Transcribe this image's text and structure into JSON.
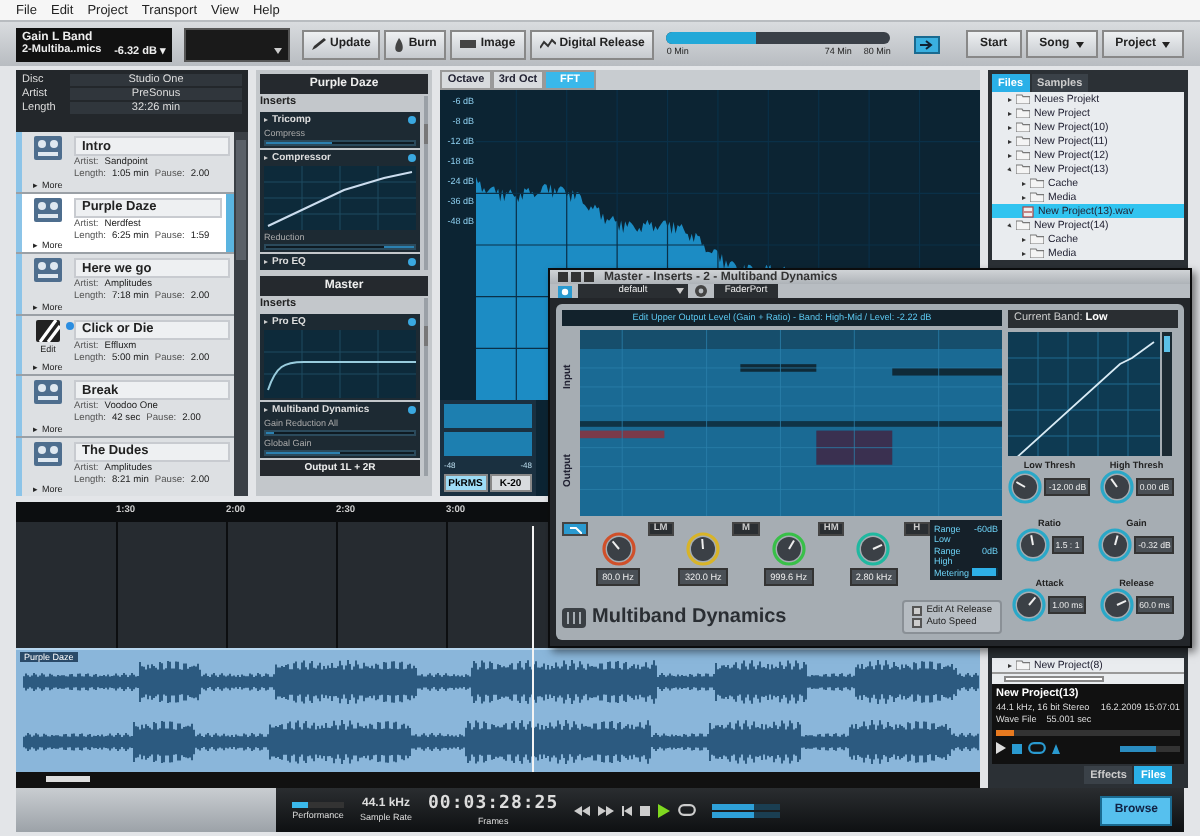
{
  "menu": [
    "File",
    "Edit",
    "Project",
    "Transport",
    "View",
    "Help"
  ],
  "toolbar": {
    "parameter": {
      "name": "Gain L Band",
      "plugin": "2-Multiba..mics",
      "value": "-6.32 dB ▾"
    },
    "actions": [
      "Update",
      "Burn",
      "Image",
      "Digital Release"
    ],
    "disc_usage": {
      "level": 0.4,
      "ticks": [
        "0 Min",
        "74 Min",
        "80 Min"
      ]
    },
    "pages": [
      {
        "label": "Start",
        "dropdown": false
      },
      {
        "label": "Song",
        "dropdown": true
      },
      {
        "label": "Project",
        "dropdown": true
      }
    ]
  },
  "disc": {
    "fields": [
      {
        "label": "Disc",
        "value": "Studio One"
      },
      {
        "label": "Artist",
        "value": "PreSonus"
      },
      {
        "label": "Length",
        "value": "32:26 min"
      }
    ]
  },
  "tracks": [
    {
      "title": "Intro",
      "kind": "cd",
      "selected": false,
      "more": "▸ More",
      "fields": [
        [
          "Artist:",
          "Sandpoint"
        ],
        [
          "Length:",
          "1:05 min"
        ],
        [
          "Pause:",
          "2.00"
        ]
      ]
    },
    {
      "title": "Purple Daze",
      "kind": "cd",
      "selected": true,
      "more": "▸ More",
      "fields": [
        [
          "Artist:",
          "Nerdfest"
        ],
        [
          "Length:",
          "6:25 min"
        ],
        [
          "Pause:",
          "1:59"
        ]
      ]
    },
    {
      "title": "Here we go",
      "kind": "cd",
      "selected": false,
      "more": "▸ More",
      "fields": [
        [
          "Artist:",
          "Amplitudes"
        ],
        [
          "Length:",
          "7:18 min"
        ],
        [
          "Pause:",
          "2.00"
        ]
      ]
    },
    {
      "title": "Click or Die",
      "kind": "edit",
      "icon_label": "Edit",
      "selected": false,
      "more": "▸ More",
      "fields": [
        [
          "Artist:",
          "Effluxm"
        ],
        [
          "Length:",
          "5:00 min"
        ],
        [
          "Pause:",
          "2.00"
        ]
      ]
    },
    {
      "title": "Break",
      "kind": "cd",
      "selected": false,
      "more": "▸ More",
      "fields": [
        [
          "Artist:",
          "Voodoo One"
        ],
        [
          "Length:",
          "42 sec"
        ],
        [
          "Pause:",
          "2.00"
        ]
      ]
    },
    {
      "title": "The Dudes",
      "kind": "cd",
      "selected": false,
      "more": "▸ More",
      "fields": [
        [
          "Artist:",
          "Amplitudes"
        ],
        [
          "Length:",
          "8:21 min"
        ],
        [
          "Pause:",
          "2.00"
        ]
      ]
    }
  ],
  "channels": [
    {
      "name": "Purple Daze",
      "inserts_label": "Inserts",
      "inserts": [
        {
          "name": "Tricomp",
          "kind": "slider",
          "params": [
            {
              "label": "Compress",
              "level": 0.45
            }
          ]
        },
        {
          "name": "Compressor",
          "kind": "curve",
          "params": [
            {
              "label": "Reduction",
              "level": 0.2
            }
          ]
        },
        {
          "name": "Pro EQ",
          "kind": "collapsed"
        }
      ]
    },
    {
      "name": "Master",
      "inserts_label": "Inserts",
      "inserts": [
        {
          "name": "Pro EQ",
          "kind": "eq"
        },
        {
          "name": "Multiband Dynamics",
          "kind": "slider",
          "params": [
            {
              "label": "Gain Reduction All",
              "level": 0.06
            },
            {
              "label": "Global Gain",
              "level": 0.5
            }
          ]
        }
      ],
      "output": "Output 1L + 2R"
    }
  ],
  "spectrum": {
    "tabs": [
      {
        "label": "Octave",
        "selected": false
      },
      {
        "label": "3rd Oct",
        "selected": false
      },
      {
        "label": "FFT",
        "selected": true
      }
    ],
    "scale": [
      "-6 dB",
      "-8 dB",
      "-12 dB",
      "-18 dB",
      "-24 dB",
      "-36 dB",
      "-48 dB"
    ],
    "meter_scale": [
      "-48",
      "-48"
    ],
    "meter_tabs": [
      {
        "label": "PkRMS",
        "selected": true
      },
      {
        "label": "K-20",
        "selected": false
      }
    ]
  },
  "timeline": {
    "ruler": [
      "1:30",
      "2:00",
      "2:30",
      "3:00"
    ],
    "clip": "Purple Daze"
  },
  "browser": {
    "tabs": [
      {
        "label": "Files",
        "selected": true
      },
      {
        "label": "Samples",
        "selected": false
      }
    ],
    "tree": [
      {
        "label": "Neues Projekt",
        "kind": "folder",
        "expanded": false,
        "selected": false
      },
      {
        "label": "New Project",
        "kind": "folder",
        "expanded": false,
        "selected": false
      },
      {
        "label": "New Project(10)",
        "kind": "folder",
        "expanded": false,
        "selected": false
      },
      {
        "label": "New Project(11)",
        "kind": "folder",
        "expanded": false,
        "selected": false
      },
      {
        "label": "New Project(12)",
        "kind": "folder",
        "expanded": false,
        "selected": false
      },
      {
        "label": "New Project(13)",
        "kind": "folder",
        "expanded": true,
        "selected": false,
        "children": [
          {
            "label": "Cache",
            "kind": "folder",
            "expanded": false,
            "selected": false
          },
          {
            "label": "Media",
            "kind": "folder",
            "expanded": false,
            "selected": false
          },
          {
            "label": "New Project(13).wav",
            "kind": "file",
            "selected": true
          }
        ]
      },
      {
        "label": "New Project(14)",
        "kind": "folder",
        "expanded": true,
        "selected": false,
        "children": [
          {
            "label": "Cache",
            "kind": "folder",
            "expanded": false,
            "selected": false
          },
          {
            "label": "Media",
            "kind": "folder",
            "expanded": false,
            "selected": false
          }
        ]
      }
    ],
    "tree_bottom": [
      {
        "label": "New Project(8)",
        "kind": "folder",
        "expanded": false,
        "selected": false
      }
    ],
    "info": {
      "name": "New Project(13)",
      "format": "44.1 kHz, 16 bit Stereo",
      "date": "16.2.2009 15:07:01",
      "type": "Wave File",
      "duration": "55.001 sec"
    },
    "preview": {
      "level": 0.1,
      "volume": {
        "level": 0.6
      }
    },
    "bottom_tabs": [
      {
        "label": "Effects",
        "selected": false
      },
      {
        "label": "Files",
        "selected": true
      }
    ]
  },
  "transport": {
    "performance": {
      "label": "Performance",
      "level": 0.3
    },
    "sample_rate": {
      "value": "44.1 kHz",
      "label": "Sample Rate"
    },
    "time": {
      "value": "00:03:28:25",
      "label": "Frames"
    },
    "playing": true,
    "output_meter": {
      "level": 0.6
    },
    "browse": {
      "label": "Browse",
      "selected": true
    }
  },
  "plugin": {
    "title": "Master - Inserts - 2 - Multiband Dynamics",
    "preset": "default",
    "device": "FaderPort",
    "hint": "Edit Upper Output Level (Gain + Ratio) - Band: High-Mid / Level: -2.22 dB",
    "input_label": "Input",
    "output_label": "Output",
    "band_buttons": [
      {
        "kind": "icon",
        "selected": true
      },
      {
        "kind": "text",
        "label": "LM",
        "selected": false
      },
      {
        "kind": "text",
        "label": "M",
        "selected": false
      },
      {
        "kind": "text",
        "label": "HM",
        "selected": false
      },
      {
        "kind": "text",
        "label": "H",
        "selected": false
      }
    ],
    "crossovers": [
      {
        "value": "80.0 Hz",
        "color": "#d0502a"
      },
      {
        "value": "320.0 Hz",
        "color": "#d8b428"
      },
      {
        "value": "999.6 Hz",
        "color": "#38c048"
      },
      {
        "value": "2.80 kHz",
        "color": "#20b8a0"
      }
    ],
    "range": [
      [
        "Range Low",
        "-60dB"
      ],
      [
        "Range High",
        "0dB"
      ]
    ],
    "metering": {
      "label": "Metering",
      "level": 0.9
    },
    "options": [
      {
        "label": "Edit At Release",
        "checked": false
      },
      {
        "label": "Auto Speed",
        "checked": false
      }
    ],
    "logo": "Multiband Dynamics",
    "current_band": {
      "label": "Current Band:",
      "value": "Low"
    },
    "controls": [
      {
        "label": "Low Thresh",
        "value": "-12.00 dB"
      },
      {
        "label": "High Thresh",
        "value": "0.00 dB"
      },
      {
        "label": "Ratio",
        "value": "1.5 : 1"
      },
      {
        "label": "Gain",
        "value": "-0.32 dB"
      },
      {
        "label": "Attack",
        "value": "1.00 ms"
      },
      {
        "label": "Release",
        "value": "60.0 ms"
      }
    ]
  }
}
